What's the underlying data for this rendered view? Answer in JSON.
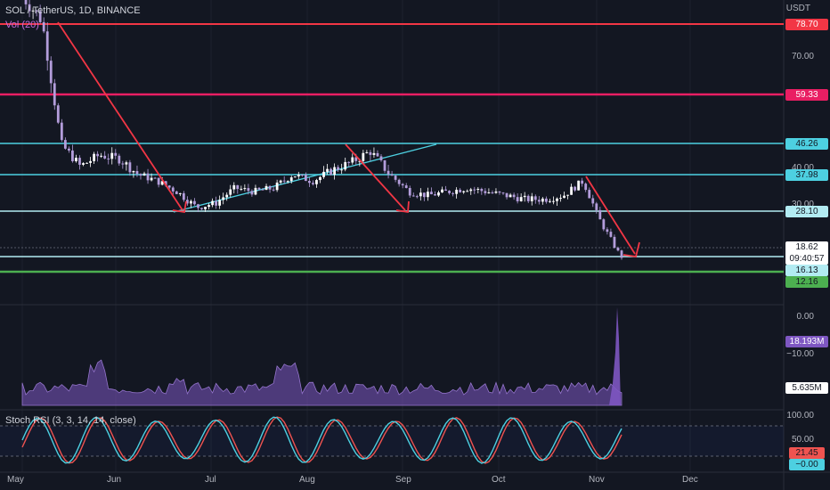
{
  "header": {
    "symbol": "SOL / TetherUS, 1D, BINANCE",
    "volume": "Vol (20)",
    "stoch_rsi": "Stoch RSI (3, 3, 14, 14, close)"
  },
  "currency": "USDT",
  "price_axis_labels": [
    "70.00",
    "40.00",
    "30.00"
  ],
  "price_tags": {
    "l1": "78.70",
    "l2": "59.33",
    "l3": "46.26",
    "l4": "37.98",
    "l5": "28.10",
    "last": "18.62",
    "countdown": "09:40:57",
    "l6": "16.13",
    "l7": "12.16"
  },
  "volume_axis": {
    "zero": "0.00",
    "neg": "−10.00",
    "vol_tag": "18.193M",
    "ma_tag": "5.635M"
  },
  "rsi_axis": {
    "top": "100.00",
    "mid": "50.00",
    "k": "21.45",
    "d": "−0.00"
  },
  "x_axis": [
    "May",
    "Jun",
    "Jul",
    "Aug",
    "Sep",
    "Oct",
    "Nov",
    "Dec"
  ],
  "colors": {
    "bg": "#131722",
    "cyan": "#4dd0e1",
    "red": "#f23645",
    "pink": "#e91e63",
    "green": "#4caf50",
    "vol": "#7e57c2",
    "rsi_k": "#2196f3",
    "rsi_d": "#ef5350"
  },
  "chart_data": {
    "type": "line",
    "x": [
      "May",
      "May",
      "May",
      "May",
      "May",
      "May",
      "Jun",
      "Jun",
      "Jun",
      "Jun",
      "Jun",
      "Jul",
      "Jul",
      "Jul",
      "Jul",
      "Jul",
      "Aug",
      "Aug",
      "Aug",
      "Aug",
      "Sep",
      "Sep",
      "Sep",
      "Sep",
      "Oct",
      "Oct",
      "Oct",
      "Oct",
      "Oct",
      "Nov",
      "Nov",
      "Nov"
    ],
    "series": [
      {
        "values": [
          88,
          80,
          46,
          40,
          43,
          42,
          38,
          36,
          33,
          29,
          30,
          34,
          33,
          34,
          38,
          36,
          39,
          41,
          44,
          38,
          33,
          32,
          33,
          34,
          33,
          32,
          31,
          31,
          32,
          36,
          24,
          16
        ]
      }
    ],
    "horizontal_levels": [
      78.7,
      59.33,
      46.26,
      37.98,
      28.1,
      16.13,
      12.16
    ],
    "last_price": 18.62
  }
}
